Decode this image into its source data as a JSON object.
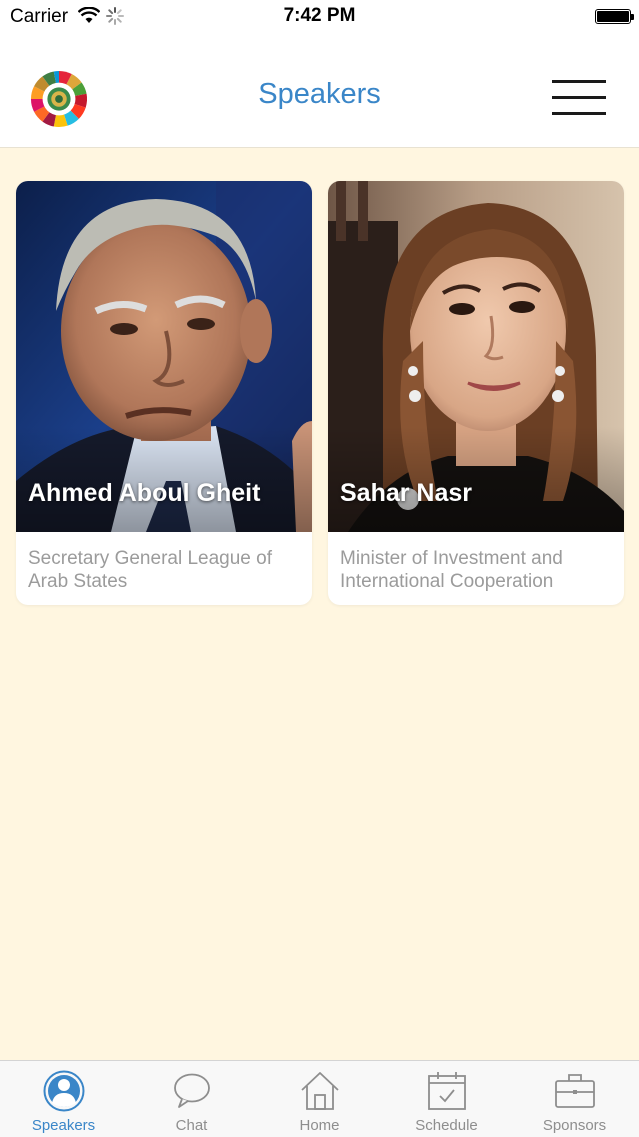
{
  "status_bar": {
    "carrier": "Carrier",
    "time": "7:42 PM"
  },
  "nav": {
    "title": "Speakers",
    "logo_icon": "sdg-wheel-logo",
    "menu_icon": "hamburger-menu-icon"
  },
  "colors": {
    "accent": "#3a86c8",
    "background": "#fff6e0",
    "card": "#ffffff",
    "subtitle": "#9b9b9b",
    "tab_inactive": "#8e8e8e"
  },
  "speakers": [
    {
      "name": "Ahmed Aboul Gheit",
      "title": "Secretary General League of Arab States"
    },
    {
      "name": "Sahar Nasr",
      "title": "Minister of Investment and International Cooperation"
    }
  ],
  "tabs": [
    {
      "label": "Speakers",
      "icon": "person-circle-icon",
      "active": true
    },
    {
      "label": "Chat",
      "icon": "speech-bubble-icon",
      "active": false
    },
    {
      "label": "Home",
      "icon": "house-icon",
      "active": false
    },
    {
      "label": "Schedule",
      "icon": "calendar-icon",
      "active": false
    },
    {
      "label": "Sponsors",
      "icon": "briefcase-icon",
      "active": false
    }
  ]
}
